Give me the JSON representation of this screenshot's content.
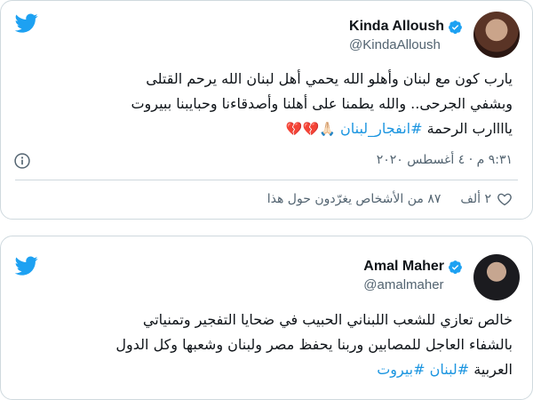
{
  "tweets": [
    {
      "author": {
        "name": "Kinda Alloush",
        "handle": "@KindaAlloush"
      },
      "text_lines": [
        "يارب كون مع لبنان وأهلو الله يحمي أهل لبنان الله يرحم القتلى",
        "وبشفي الجرحى.. والله يطمنا على أهلنا وأصدقاءنا وحبايبنا ببيروت"
      ],
      "last_line_text": "ياااارب الرحمة",
      "hashtag": "#انفجار_لبنان",
      "emoji": "🙏🏻💔💔",
      "timestamp": "٩:٣١ م · ٤ أغسطس ٢٠٢٠",
      "likes": "٢ ألف",
      "talking": "٨٧ من الأشخاص يغرّدون حول هذا"
    },
    {
      "author": {
        "name": "Amal Maher",
        "handle": "@amalmaher"
      },
      "text_lines": [
        "خالص تعازي للشعب اللبناني الحبيب في ضحايا التفجير  وتمنياتي",
        "بالشفاء العاجل للمصابين وربنا يحفظ مصر ولبنان وشعبها وكل الدول"
      ],
      "last_line_text": "العربية",
      "hashtags": [
        "#لبنان",
        "#بيروت"
      ]
    }
  ],
  "colors": {
    "brand": "#1da1f2",
    "hashtag": "#1b95e0",
    "text": "#0f1419",
    "muted": "#536471",
    "border": "#cfd9de",
    "heart": "#e0245e"
  },
  "icons": [
    "twitter-bird-icon",
    "verified-badge-icon",
    "info-icon",
    "heart-outline-icon",
    "broken-heart-emoji",
    "folded-hands-emoji"
  ]
}
